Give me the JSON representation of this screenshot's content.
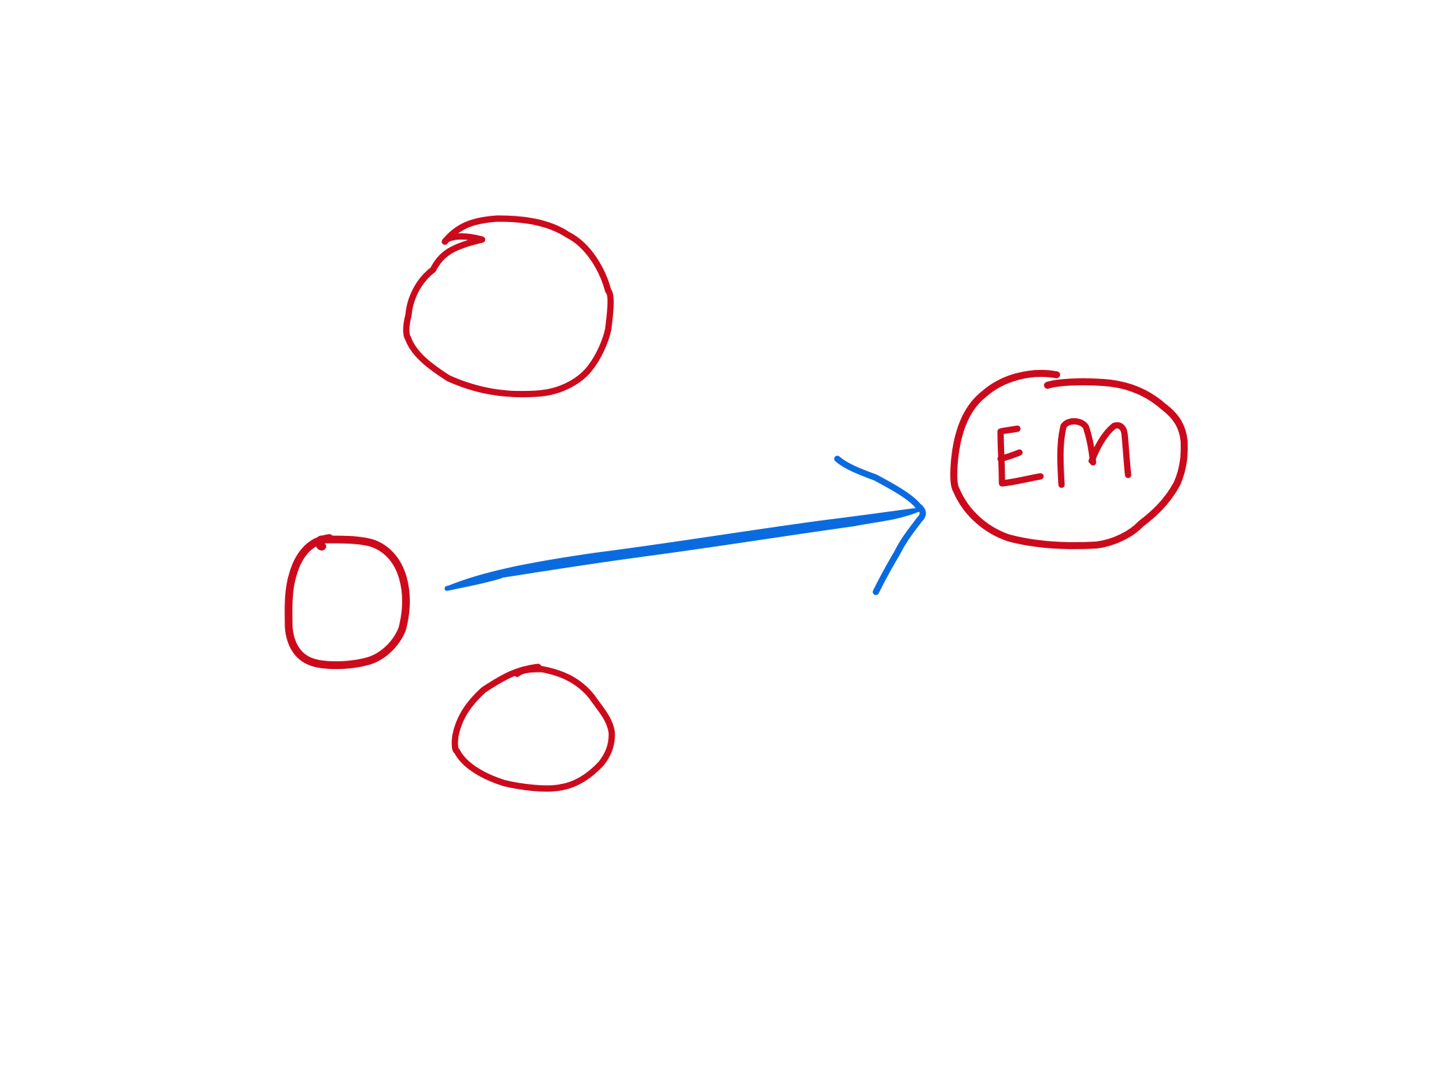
{
  "diagram": {
    "colors": {
      "background": "#ffffff",
      "node_stroke": "#cc0a1c",
      "arrow": "#0a6be0"
    },
    "nodes": [
      {
        "id": "top",
        "label": ""
      },
      {
        "id": "left",
        "label": ""
      },
      {
        "id": "bottom",
        "label": ""
      },
      {
        "id": "target",
        "label": "EM"
      }
    ],
    "edges": [
      {
        "from": "left",
        "to": "target",
        "style": "arrow"
      }
    ]
  }
}
